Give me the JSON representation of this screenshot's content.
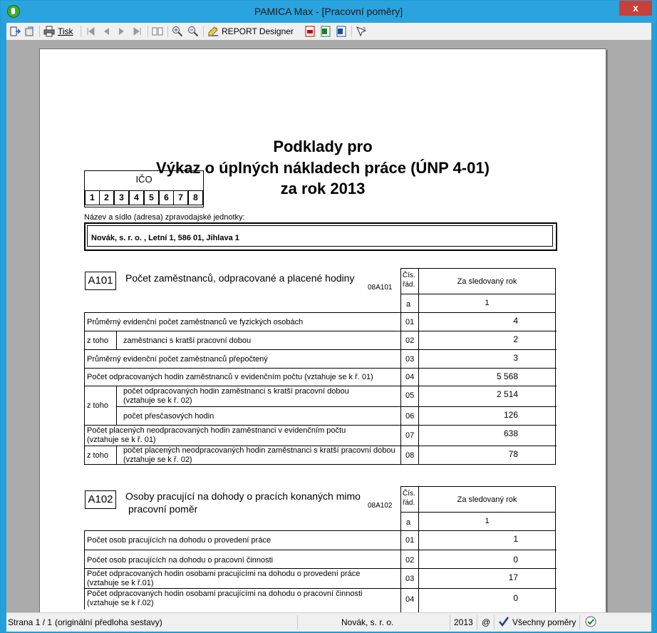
{
  "window": {
    "title": "PAMICA Max - [Pracovní poměry]",
    "close": "x"
  },
  "toolbar": {
    "print_label": "Tisk",
    "report_designer_label": "REPORT Designer"
  },
  "report": {
    "title_line1": "Podklady pro",
    "title_line2": "Výkaz o úplných nákladech práce (ÚNP 4-01)",
    "title_line3": "za rok 2013",
    "ico_label": "IČO",
    "ico_digits": [
      "1",
      "2",
      "3",
      "4",
      "5",
      "6",
      "7",
      "8"
    ],
    "name_label": "Název a sídlo (adresa) zpravodajské jednotky:",
    "name_value": "Novák, s. r. o. , Letní  1, 586 01, Jihlava 1",
    "sections": [
      {
        "code": "A101",
        "title": "Počet zaměstnanců, odpracované a placené hodiny",
        "code2": "08A101",
        "col_row": "Čís. řád.",
        "col_year": "Za sledovaný rok",
        "col_a": "a",
        "col_1": "1",
        "rows": [
          {
            "label": "Průměrný evidenční počet zaměstnanců ve fyzických osobách",
            "num": "01",
            "value": "4"
          },
          {
            "group": "z toho",
            "label": "zaměstnanci s kratší pracovní dobou",
            "num": "02",
            "value": "2"
          },
          {
            "label": "Průměrný evidenční počet zaměstnanců přepočtený",
            "num": "03",
            "value": "3"
          },
          {
            "label": "Počet odpracovaných hodin zaměstnanců v evidenčním počtu (vztahuje se k ř. 01)",
            "num": "04",
            "value": "5 568"
          },
          {
            "group": "z toho",
            "label": "počet odpracovaných hodin zaměstnanci s kratší pracovní dobou",
            "label2": "(vztahuje se k ř. 02)",
            "num": "05",
            "value": "2 514"
          },
          {
            "label": "počet přesčasových hodin",
            "num": "06",
            "value": "126"
          },
          {
            "label": "Počet placených neodpracovaných hodin zaměstnanci v evidenčním počtu",
            "label2": "(vztahuje se k ř. 01)",
            "num": "07",
            "value": "638"
          },
          {
            "group": "z toho",
            "label": "počet placených neodpracovaných hodin zaměstnanci s kratší pracovní dobou",
            "label2": "(vztahuje se k ř. 02)",
            "num": "08",
            "value": "78"
          }
        ]
      },
      {
        "code": "A102",
        "title": "Osoby pracující na dohody o pracích konaných mimo",
        "title2": "pracovní poměr",
        "code2": "08A102",
        "col_row": "Čís. řád.",
        "col_year": "Za sledovaný rok",
        "col_a": "a",
        "col_1": "1",
        "rows": [
          {
            "label": "Počet osob pracujících na dohodu o provedení práce",
            "num": "01",
            "value": "1"
          },
          {
            "label": "Počet osob pracujících na dohodu o pracovní činnosti",
            "num": "02",
            "value": "0"
          },
          {
            "label": "Počet odpracovaných hodin osobami pracujícími na dohodu o provedení práce",
            "label2": "(vztahuje se k ř.01)",
            "num": "03",
            "value": "17"
          },
          {
            "label": "Počet odpracovaných hodin osobami pracujícími na dohodu o pracovní činnosti",
            "label2": "(vztahuje se k ř.02)",
            "num": "04",
            "value": "0"
          }
        ]
      }
    ]
  },
  "status": {
    "page": "Strana 1 / 1",
    "template": "(originální předloha sestavy)",
    "company": "Novák, s. r. o.",
    "year": "2013",
    "at": "@",
    "filter": "Všechny poměry"
  }
}
